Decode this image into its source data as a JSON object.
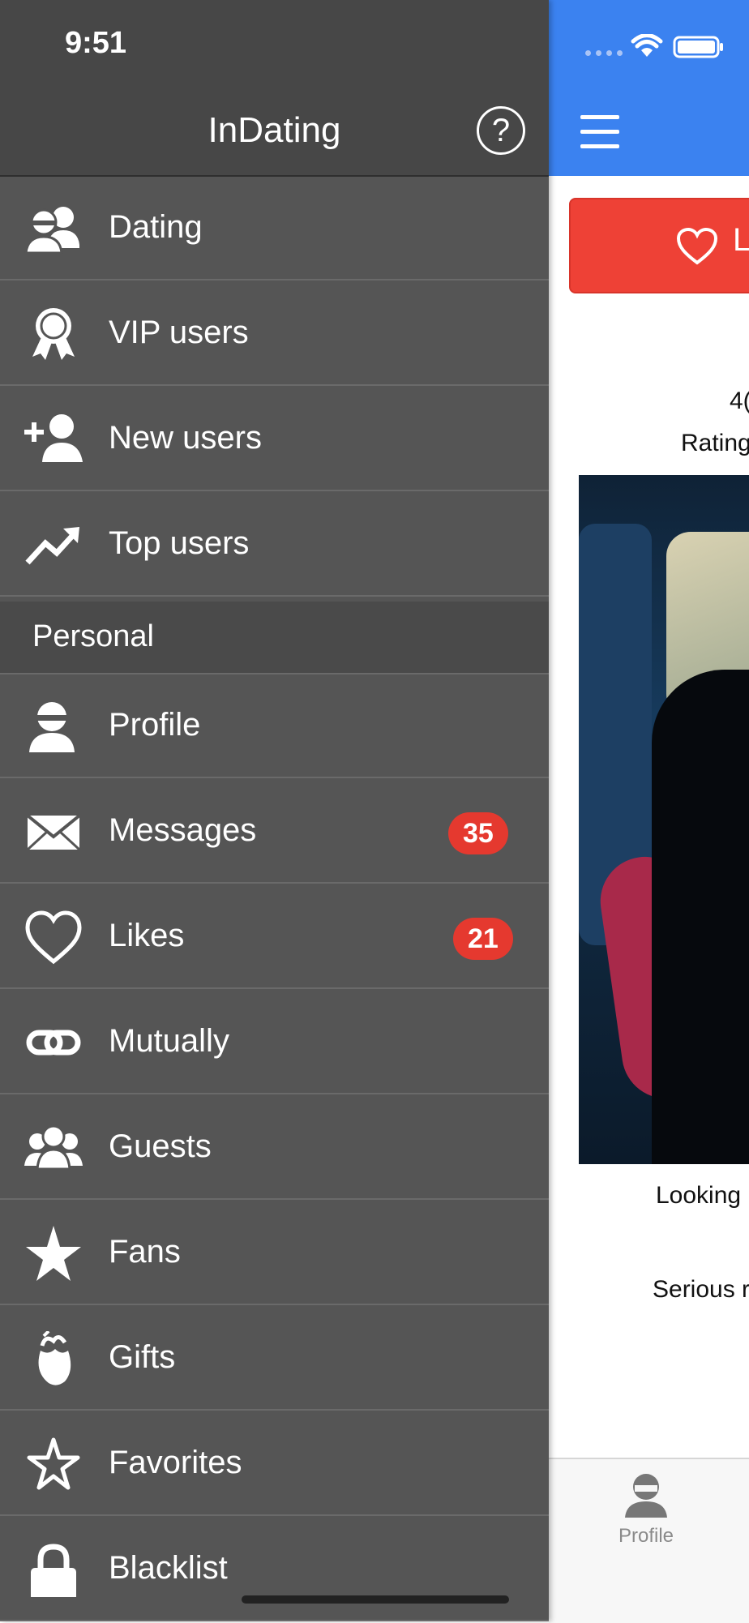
{
  "status_bar": {
    "time": "9:51"
  },
  "drawer": {
    "title": "InDating",
    "help_symbol": "?",
    "items_top": [
      {
        "label": "Dating",
        "icon": "dating-users-icon"
      },
      {
        "label": "VIP users",
        "icon": "ribbon-award-icon"
      },
      {
        "label": "New users",
        "icon": "add-user-icon"
      },
      {
        "label": "Top users",
        "icon": "trending-up-icon"
      }
    ],
    "section_title": "Personal",
    "items_personal": [
      {
        "label": "Profile",
        "icon": "user-icon"
      },
      {
        "label": "Messages",
        "icon": "envelope-icon",
        "badge": "35"
      },
      {
        "label": "Likes",
        "icon": "heart-icon",
        "badge": "21"
      },
      {
        "label": "Mutually",
        "icon": "link-icon"
      },
      {
        "label": "Guests",
        "icon": "group-icon"
      },
      {
        "label": "Fans",
        "icon": "star-filled-icon"
      },
      {
        "label": "Gifts",
        "icon": "gift-flower-icon"
      },
      {
        "label": "Favorites",
        "icon": "star-outline-icon"
      },
      {
        "label": "Blacklist",
        "icon": "lock-icon"
      }
    ]
  },
  "main": {
    "like_button_label": "L",
    "counter_text": "4(",
    "rating_text": "Rating",
    "looking_text": "Looking",
    "serious_text": "Serious r",
    "tab_profile_label": "Profile"
  },
  "colors": {
    "header_blue": "#3b82f0",
    "drawer_bg": "#555555",
    "badge_red": "#e5392f",
    "like_red": "#ee4136"
  }
}
